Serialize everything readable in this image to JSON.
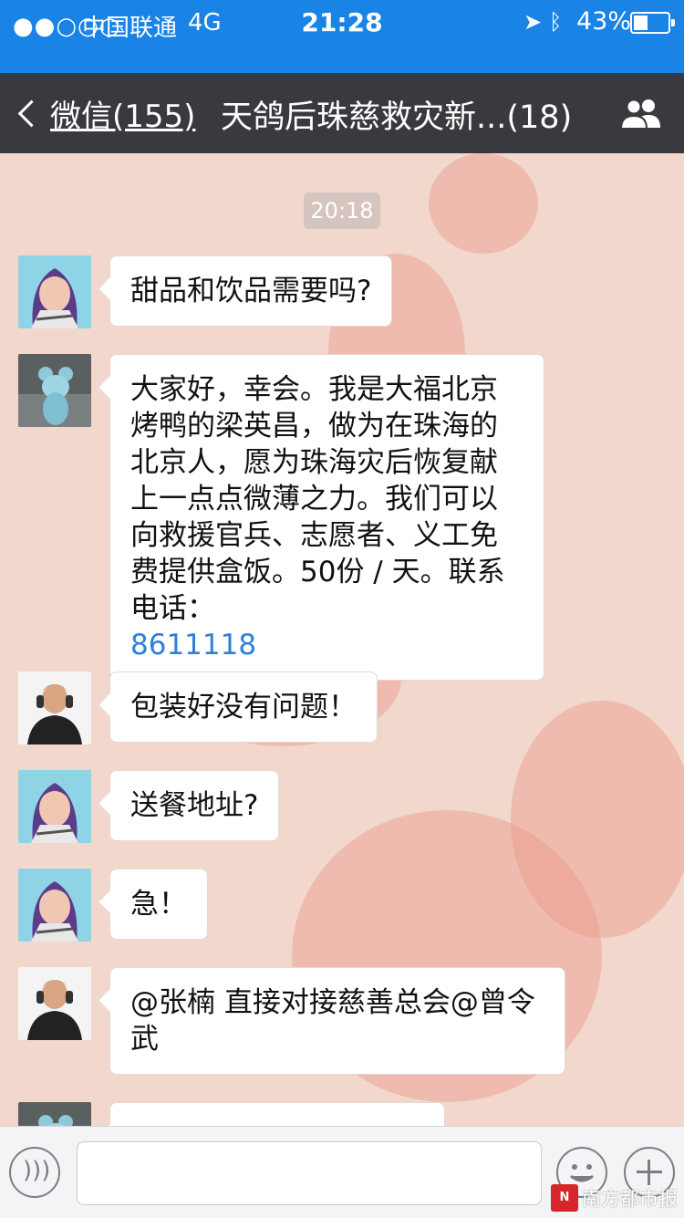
{
  "status_bar": {
    "signal": "●●○○○",
    "carrier": "中国联通",
    "network": "4G",
    "time": "21:28",
    "battery_percent": "43%",
    "battery_level": 0.43
  },
  "nav": {
    "back_label": "微信(155)",
    "title": "天鸽后珠慈救灾新...(18)"
  },
  "chat": {
    "timestamp": "20:18",
    "messages": [
      {
        "text": "甜品和饮品需要吗?"
      },
      {
        "text": "大家好，幸会。我是大福北京烤鸭的梁英昌，做为在珠海的北京人，愿为珠海灾后恢复献上一点点微薄之力。我们可以向救援官兵、志愿者、义工免费提供盒饭。50份 / 天。联系电话：",
        "link": "8611118"
      },
      {
        "text": "包装好没有问题！"
      },
      {
        "text": "送餐地址?"
      },
      {
        "text": "急！"
      },
      {
        "text": "@张楠 直接对接慈善总会@曾令武"
      }
    ]
  },
  "watermark": {
    "text": "南方都市报",
    "logo": "N"
  }
}
